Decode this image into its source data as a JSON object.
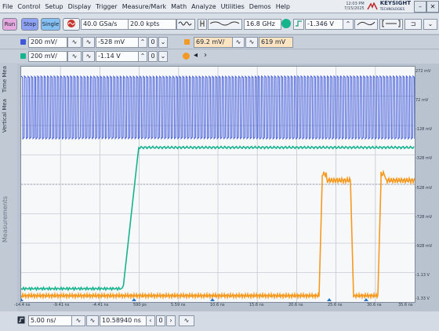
{
  "menu": {
    "items": [
      "File",
      "Control",
      "Setup",
      "Display",
      "Trigger",
      "Measure/Mark",
      "Math",
      "Analyze",
      "Utilities",
      "Demos",
      "Help"
    ],
    "datetime_line1": "12:03 PM",
    "datetime_line2": "7/15/2025",
    "brand_name": "KEYSIGHT",
    "brand_sub": "TECHNOLOGIES",
    "close_glyph": "✕",
    "minimize_glyph": "–"
  },
  "toolbar": {
    "run_label": "Run",
    "stop_label": "Stop",
    "single_label": "Single",
    "sample_rate": "40.0 GSa/s",
    "memory_depth": "20.0 kpts",
    "bandwidth": "16.8 GHz",
    "trigger_level": "-1.346 V"
  },
  "channels": {
    "ch1": {
      "color": "#3f56d8",
      "scale": "200 mV/",
      "offset": "-528 mV"
    },
    "ch3": {
      "color": "#f39a24",
      "scale": "69.2 mV/",
      "offset": "619 mV"
    },
    "ch4": {
      "color": "#17b38a",
      "scale": "200 mV/",
      "offset": "-1.14 V"
    }
  },
  "sidebar": {
    "tabs": [
      "Time Mea",
      "Vertical Mea"
    ],
    "measurements_label": "Measurements"
  },
  "graticule": {
    "y_labels": [
      "272 mV",
      "72 mV",
      "-128 mV",
      "-328 mV",
      "-528 mV",
      "-728 mV",
      "-928 mV",
      "-1.13 V",
      "-1.33 V"
    ],
    "x_labels": [
      "-14.4 ns",
      "-9.41 ns",
      "-4.41 ns",
      "590 ps",
      "5.59 ns",
      "10.6 ns",
      "15.6 ns",
      "20.6 ns",
      "25.6 ns",
      "30.6 ns",
      "35.6 ns"
    ]
  },
  "timebase": {
    "scale": "5.00 ns/",
    "position": "10.58940 ns"
  },
  "colors": {
    "ch1": "#3b55d6",
    "ch3": "#f59a1f",
    "ch4": "#16b38d",
    "run": "#d98fd0",
    "stop": "#7f95f5",
    "single": "#78b7f0"
  }
}
